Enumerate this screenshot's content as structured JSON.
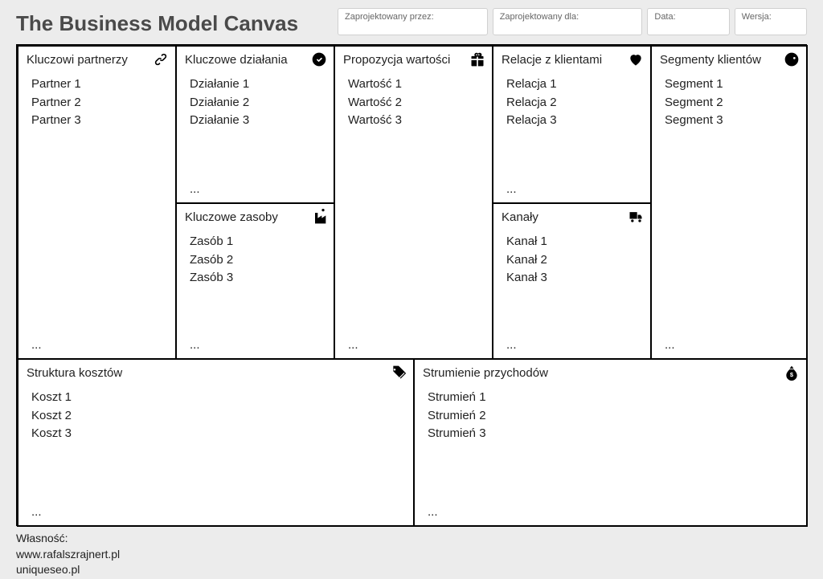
{
  "title": "The Business Model Canvas",
  "meta": {
    "designed_by_label": "Zaprojektowany przez:",
    "designed_for_label": "Zaprojektowany dla:",
    "date_label": "Data:",
    "version_label": "Wersja:"
  },
  "blocks": {
    "partners": {
      "title": "Kluczowi partnerzy",
      "items": [
        "Partner 1",
        "Partner 2",
        "Partner 3"
      ],
      "more": "..."
    },
    "activities": {
      "title": "Kluczowe działania",
      "items": [
        "Działanie 1",
        "Działanie 2",
        "Działanie 3"
      ],
      "more": "..."
    },
    "resources": {
      "title": "Kluczowe zasoby",
      "items": [
        "Zasób 1",
        "Zasób 2",
        "Zasób 3"
      ],
      "more": "..."
    },
    "value": {
      "title": "Propozycja wartości",
      "items": [
        "Wartość 1",
        "Wartość 2",
        "Wartość 3"
      ],
      "more": "..."
    },
    "relations": {
      "title": "Relacje z klientami",
      "items": [
        "Relacja 1",
        "Relacja 2",
        "Relacja 3"
      ],
      "more": "..."
    },
    "channels": {
      "title": "Kanały",
      "items": [
        "Kanał 1",
        "Kanał 2",
        "Kanał 3"
      ],
      "more": "..."
    },
    "segments": {
      "title": "Segmenty klientów",
      "items": [
        "Segment 1",
        "Segment 2",
        "Segment 3"
      ],
      "more": "..."
    },
    "costs": {
      "title": "Struktura kosztów",
      "items": [
        "Koszt 1",
        "Koszt 2",
        "Koszt 3"
      ],
      "more": "..."
    },
    "revenue": {
      "title": "Strumienie przychodów",
      "items": [
        "Strumień 1",
        "Strumień 2",
        "Strumień 3"
      ],
      "more": "..."
    }
  },
  "footer": {
    "owner_label": "Własność:",
    "line1": "www.rafalszrajnert.pl",
    "line2": "uniqueseo.pl"
  },
  "connectors": {
    "color_blue": "#1E88D6",
    "color_green": "#9ACD32"
  }
}
